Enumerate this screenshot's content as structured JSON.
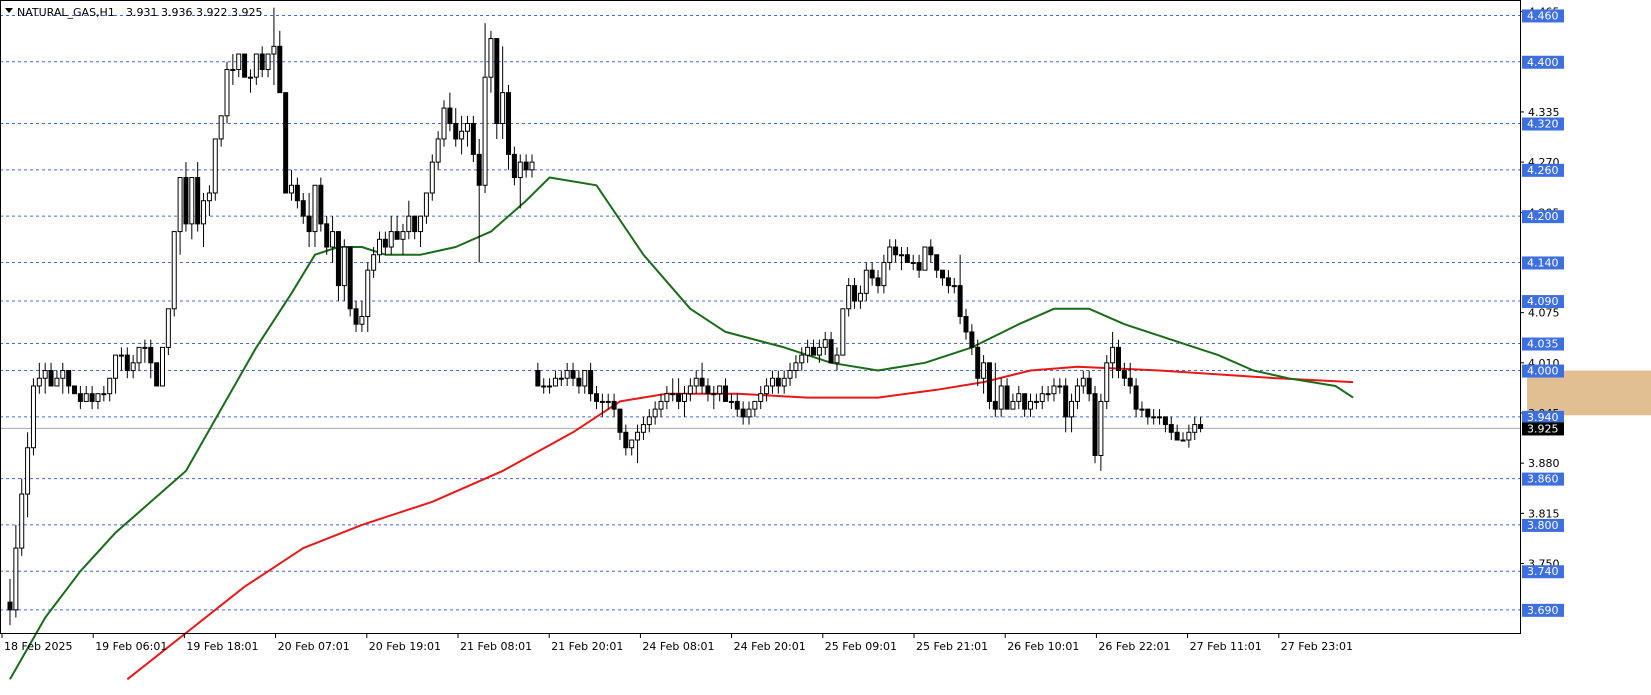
{
  "header": {
    "symbol": "NATURAL_GAS,H1",
    "ohlc": "3.931 3.936 3.922 3.925",
    "arrow_icon": "triangle-down-icon"
  },
  "colors": {
    "background": "#ffffff",
    "candle": "#000000",
    "grid_level": "#1f4fd6",
    "level_label_bg": "#3d6fe0",
    "current_price_bg": "#000000",
    "ma_fast": "#1a6b1a",
    "ma_slow": "#e81818",
    "zone_fill": "#deb887",
    "border": "#000000"
  },
  "chart_data": {
    "type": "candlestick",
    "title": "NATURAL_GAS,H1",
    "ylim": [
      3.66,
      4.48
    ],
    "price_levels": [
      4.46,
      4.4,
      4.32,
      4.26,
      4.2,
      4.14,
      4.09,
      4.035,
      4.0,
      3.94,
      3.86,
      3.8,
      3.74,
      3.69
    ],
    "price_level_labels": [
      "4.460",
      "4.400",
      "4.320",
      "4.260",
      "4.200",
      "4.140",
      "4.090",
      "4.035",
      "4.000",
      "3.940",
      "3.860",
      "3.800",
      "3.740",
      "3.690"
    ],
    "scale_ticks": [
      4.465,
      4.335,
      4.27,
      4.205,
      4.075,
      4.01,
      3.945,
      3.88,
      3.815,
      3.75
    ],
    "scale_tick_labels": [
      "4.465",
      "4.335",
      "4.270",
      "4.205",
      "4.075",
      "4.010",
      "3.945",
      "3.880",
      "3.815",
      "3.750"
    ],
    "current_price": 3.925,
    "current_price_label": "3.925",
    "time_labels": [
      "18 Feb 2025",
      "19 Feb 06:01",
      "19 Feb 18:01",
      "20 Feb 07:01",
      "20 Feb 19:01",
      "21 Feb 08:01",
      "21 Feb 20:01",
      "24 Feb 08:01",
      "24 Feb 20:01",
      "25 Feb 09:01",
      "25 Feb 21:01",
      "26 Feb 10:01",
      "26 Feb 22:01",
      "27 Feb 11:01",
      "27 Feb 23:01"
    ],
    "zone": {
      "from_bar": 259,
      "to_bar": 280,
      "low": 3.942,
      "high": 4.0
    },
    "candles": [
      [
        3.7,
        3.73,
        3.67,
        3.69
      ],
      [
        3.69,
        3.8,
        3.68,
        3.77
      ],
      [
        3.77,
        3.86,
        3.76,
        3.84
      ],
      [
        3.84,
        3.92,
        3.81,
        3.9
      ],
      [
        3.9,
        3.99,
        3.89,
        3.98
      ],
      [
        3.98,
        4.01,
        3.97,
        3.99
      ],
      [
        3.99,
        4.01,
        3.97,
        4.0
      ],
      [
        4.0,
        4.01,
        3.98,
        3.98
      ],
      [
        3.98,
        4.0,
        3.98,
        3.99
      ],
      [
        3.99,
        4.01,
        3.97,
        4.0
      ],
      [
        4.0,
        4.0,
        3.97,
        3.98
      ],
      [
        3.98,
        3.98,
        3.97,
        3.97
      ],
      [
        3.97,
        3.98,
        3.95,
        3.96
      ],
      [
        3.96,
        3.98,
        3.96,
        3.97
      ],
      [
        3.97,
        3.98,
        3.95,
        3.96
      ],
      [
        3.96,
        3.97,
        3.95,
        3.97
      ],
      [
        3.97,
        3.98,
        3.96,
        3.97
      ],
      [
        3.97,
        3.99,
        3.96,
        3.99
      ],
      [
        3.99,
        4.02,
        3.97,
        4.02
      ],
      [
        4.02,
        4.03,
        4.0,
        4.02
      ],
      [
        4.02,
        4.03,
        3.99,
        4.0
      ],
      [
        4.0,
        4.02,
        3.99,
        4.01
      ],
      [
        4.01,
        4.03,
        4.0,
        4.03
      ],
      [
        4.03,
        4.04,
        4.01,
        4.03
      ],
      [
        4.03,
        4.04,
        3.99,
        4.01
      ],
      [
        4.01,
        4.01,
        3.98,
        3.98
      ],
      [
        3.98,
        4.03,
        3.98,
        4.03
      ],
      [
        4.03,
        4.08,
        4.02,
        4.08
      ],
      [
        4.08,
        4.18,
        4.07,
        4.18
      ],
      [
        4.18,
        4.25,
        4.15,
        4.25
      ],
      [
        4.25,
        4.27,
        4.18,
        4.19
      ],
      [
        4.19,
        4.25,
        4.17,
        4.25
      ],
      [
        4.25,
        4.27,
        4.18,
        4.19
      ],
      [
        4.19,
        4.23,
        4.16,
        4.22
      ],
      [
        4.22,
        4.24,
        4.2,
        4.23
      ],
      [
        4.23,
        4.3,
        4.22,
        4.3
      ],
      [
        4.3,
        4.33,
        4.29,
        4.33
      ],
      [
        4.33,
        4.4,
        4.32,
        4.39
      ],
      [
        4.39,
        4.41,
        4.37,
        4.39
      ],
      [
        4.39,
        4.41,
        4.38,
        4.41
      ],
      [
        4.41,
        4.41,
        4.38,
        4.38
      ],
      [
        4.38,
        4.39,
        4.36,
        4.38
      ],
      [
        4.38,
        4.41,
        4.37,
        4.41
      ],
      [
        4.41,
        4.42,
        4.38,
        4.39
      ],
      [
        4.39,
        4.41,
        4.38,
        4.41
      ],
      [
        4.41,
        4.47,
        4.37,
        4.42
      ],
      [
        4.42,
        4.44,
        4.36,
        4.36
      ],
      [
        4.36,
        4.36,
        4.23,
        4.23
      ],
      [
        4.23,
        4.26,
        4.22,
        4.24
      ],
      [
        4.24,
        4.25,
        4.21,
        4.22
      ],
      [
        4.22,
        4.23,
        4.19,
        4.2
      ],
      [
        4.2,
        4.23,
        4.16,
        4.18
      ],
      [
        4.18,
        4.24,
        4.16,
        4.24
      ],
      [
        4.24,
        4.25,
        4.18,
        4.19
      ],
      [
        4.19,
        4.2,
        4.15,
        4.16
      ],
      [
        4.16,
        4.2,
        4.14,
        4.18
      ],
      [
        4.18,
        4.18,
        4.09,
        4.11
      ],
      [
        4.11,
        4.17,
        4.09,
        4.16
      ],
      [
        4.16,
        4.16,
        4.07,
        4.08
      ],
      [
        4.08,
        4.09,
        4.05,
        4.06
      ],
      [
        4.06,
        4.09,
        4.05,
        4.07
      ],
      [
        4.07,
        4.14,
        4.05,
        4.13
      ],
      [
        4.13,
        4.16,
        4.12,
        4.15
      ],
      [
        4.15,
        4.18,
        4.14,
        4.17
      ],
      [
        4.17,
        4.18,
        4.15,
        4.16
      ],
      [
        4.16,
        4.2,
        4.15,
        4.18
      ],
      [
        4.18,
        4.2,
        4.17,
        4.17
      ],
      [
        4.17,
        4.19,
        4.15,
        4.18
      ],
      [
        4.18,
        4.22,
        4.17,
        4.2
      ],
      [
        4.2,
        4.2,
        4.17,
        4.18
      ],
      [
        4.18,
        4.2,
        4.16,
        4.2
      ],
      [
        4.2,
        4.23,
        4.19,
        4.23
      ],
      [
        4.23,
        4.28,
        4.22,
        4.27
      ],
      [
        4.27,
        4.31,
        4.26,
        4.3
      ],
      [
        4.3,
        4.35,
        4.29,
        4.34
      ],
      [
        4.34,
        4.36,
        4.31,
        4.32
      ],
      [
        4.32,
        4.34,
        4.29,
        4.3
      ],
      [
        4.3,
        4.33,
        4.28,
        4.31
      ],
      [
        4.31,
        4.33,
        4.29,
        4.32
      ],
      [
        4.32,
        4.33,
        4.27,
        4.28
      ],
      [
        4.28,
        4.3,
        4.14,
        4.24
      ],
      [
        4.24,
        4.45,
        4.23,
        4.38
      ],
      [
        4.38,
        4.44,
        4.36,
        4.43
      ],
      [
        4.43,
        4.43,
        4.3,
        4.32
      ],
      [
        4.32,
        4.42,
        4.3,
        4.36
      ],
      [
        4.36,
        4.37,
        4.26,
        4.28
      ],
      [
        4.28,
        4.29,
        4.24,
        4.25
      ],
      [
        4.25,
        4.28,
        4.21,
        4.27
      ],
      [
        4.27,
        4.28,
        4.25,
        4.26
      ],
      [
        4.26,
        4.28,
        4.25,
        4.27
      ],
      [
        4.0,
        4.01,
        3.98,
        3.98
      ],
      [
        3.98,
        3.99,
        3.97,
        3.98
      ],
      [
        3.98,
        3.99,
        3.97,
        3.98
      ],
      [
        3.98,
        4.0,
        3.98,
        3.99
      ],
      [
        3.99,
        4.0,
        3.98,
        3.99
      ],
      [
        3.99,
        4.01,
        3.98,
        4.0
      ],
      [
        4.0,
        4.01,
        3.98,
        3.99
      ],
      [
        3.99,
        4.0,
        3.97,
        3.98
      ],
      [
        3.98,
        4.0,
        3.97,
        4.0
      ],
      [
        4.0,
        4.01,
        3.96,
        3.97
      ],
      [
        3.97,
        3.98,
        3.95,
        3.96
      ],
      [
        3.96,
        3.97,
        3.94,
        3.96
      ],
      [
        3.96,
        3.97,
        3.95,
        3.96
      ],
      [
        3.96,
        3.97,
        3.94,
        3.95
      ],
      [
        3.95,
        3.95,
        3.91,
        3.92
      ],
      [
        3.92,
        3.93,
        3.89,
        3.9
      ],
      [
        3.9,
        3.91,
        3.89,
        3.91
      ],
      [
        3.91,
        3.93,
        3.88,
        3.92
      ],
      [
        3.92,
        3.94,
        3.91,
        3.93
      ],
      [
        3.93,
        3.95,
        3.92,
        3.94
      ],
      [
        3.94,
        3.96,
        3.93,
        3.95
      ],
      [
        3.95,
        3.97,
        3.94,
        3.96
      ],
      [
        3.96,
        3.98,
        3.95,
        3.97
      ],
      [
        3.97,
        3.99,
        3.96,
        3.97
      ],
      [
        3.97,
        3.99,
        3.95,
        3.96
      ],
      [
        3.96,
        3.98,
        3.94,
        3.97
      ],
      [
        3.97,
        3.99,
        3.96,
        3.98
      ],
      [
        3.98,
        4.0,
        3.97,
        3.99
      ],
      [
        3.99,
        4.01,
        3.97,
        3.98
      ],
      [
        3.98,
        3.99,
        3.96,
        3.97
      ],
      [
        3.97,
        3.98,
        3.95,
        3.97
      ],
      [
        3.97,
        3.98,
        3.96,
        3.98
      ],
      [
        3.98,
        3.99,
        3.96,
        3.96
      ],
      [
        3.96,
        3.97,
        3.95,
        3.96
      ],
      [
        3.96,
        3.97,
        3.94,
        3.95
      ],
      [
        3.95,
        3.96,
        3.93,
        3.94
      ],
      [
        3.94,
        3.96,
        3.93,
        3.95
      ],
      [
        3.95,
        3.96,
        3.94,
        3.96
      ],
      [
        3.96,
        3.98,
        3.95,
        3.97
      ],
      [
        3.97,
        3.99,
        3.96,
        3.98
      ],
      [
        3.98,
        4.0,
        3.97,
        3.99
      ],
      [
        3.99,
        4.0,
        3.97,
        3.98
      ],
      [
        3.98,
        4.0,
        3.97,
        3.99
      ],
      [
        3.99,
        4.01,
        3.98,
        4.0
      ],
      [
        4.0,
        4.02,
        3.99,
        4.01
      ],
      [
        4.01,
        4.03,
        4.0,
        4.02
      ],
      [
        4.02,
        4.04,
        4.01,
        4.03
      ],
      [
        4.03,
        4.04,
        4.02,
        4.02
      ],
      [
        4.02,
        4.04,
        4.01,
        4.03
      ],
      [
        4.03,
        4.05,
        4.02,
        4.04
      ],
      [
        4.04,
        4.05,
        4.01,
        4.01
      ],
      [
        4.01,
        4.03,
        4.0,
        4.02
      ],
      [
        4.02,
        4.08,
        4.02,
        4.08
      ],
      [
        4.08,
        4.12,
        4.07,
        4.11
      ],
      [
        4.11,
        4.12,
        4.08,
        4.09
      ],
      [
        4.09,
        4.11,
        4.08,
        4.1
      ],
      [
        4.1,
        4.14,
        4.09,
        4.13
      ],
      [
        4.13,
        4.14,
        4.11,
        4.12
      ],
      [
        4.12,
        4.13,
        4.1,
        4.11
      ],
      [
        4.11,
        4.15,
        4.1,
        4.14
      ],
      [
        4.14,
        4.17,
        4.13,
        4.16
      ],
      [
        4.16,
        4.17,
        4.14,
        4.15
      ],
      [
        4.15,
        4.16,
        4.13,
        4.15
      ],
      [
        4.15,
        4.16,
        4.14,
        4.14
      ],
      [
        4.14,
        4.15,
        4.13,
        4.14
      ],
      [
        4.14,
        4.15,
        4.12,
        4.13
      ],
      [
        4.13,
        4.16,
        4.13,
        4.16
      ],
      [
        4.16,
        4.17,
        4.14,
        4.15
      ],
      [
        4.15,
        4.15,
        4.12,
        4.13
      ],
      [
        4.13,
        4.13,
        4.11,
        4.12
      ],
      [
        4.12,
        4.13,
        4.1,
        4.11
      ],
      [
        4.11,
        4.12,
        4.1,
        4.11
      ],
      [
        4.11,
        4.15,
        4.06,
        4.07
      ],
      [
        4.07,
        4.08,
        4.04,
        4.05
      ],
      [
        4.05,
        4.06,
        4.02,
        4.03
      ],
      [
        4.03,
        4.04,
        3.98,
        3.99
      ],
      [
        3.99,
        4.02,
        3.97,
        4.01
      ],
      [
        4.01,
        4.01,
        3.95,
        3.96
      ],
      [
        3.96,
        4.01,
        3.94,
        3.95
      ],
      [
        3.95,
        3.99,
        3.94,
        3.98
      ],
      [
        3.98,
        3.99,
        3.95,
        3.95
      ],
      [
        3.95,
        3.97,
        3.95,
        3.96
      ],
      [
        3.96,
        3.98,
        3.95,
        3.97
      ],
      [
        3.97,
        3.97,
        3.94,
        3.95
      ],
      [
        3.95,
        3.97,
        3.94,
        3.96
      ],
      [
        3.96,
        3.97,
        3.95,
        3.96
      ],
      [
        3.96,
        3.98,
        3.95,
        3.97
      ],
      [
        3.97,
        3.98,
        3.96,
        3.97
      ],
      [
        3.97,
        3.99,
        3.96,
        3.98
      ],
      [
        3.98,
        3.99,
        3.97,
        3.98
      ],
      [
        3.98,
        3.99,
        3.92,
        3.94
      ],
      [
        3.94,
        3.97,
        3.92,
        3.96
      ],
      [
        3.96,
        3.99,
        3.95,
        3.98
      ],
      [
        3.98,
        4.0,
        3.97,
        3.99
      ],
      [
        3.99,
        4.0,
        3.96,
        3.97
      ],
      [
        3.97,
        3.98,
        3.88,
        3.89
      ],
      [
        3.89,
        3.97,
        3.87,
        3.96
      ],
      [
        3.96,
        4.02,
        3.95,
        4.01
      ],
      [
        4.01,
        4.05,
        3.99,
        4.03
      ],
      [
        4.03,
        4.04,
        3.99,
        4.0
      ],
      [
        4.0,
        4.01,
        3.98,
        3.99
      ],
      [
        3.99,
        4.01,
        3.97,
        3.98
      ],
      [
        3.98,
        3.99,
        3.94,
        3.95
      ],
      [
        3.95,
        3.96,
        3.94,
        3.95
      ],
      [
        3.95,
        3.95,
        3.93,
        3.94
      ],
      [
        3.94,
        3.95,
        3.93,
        3.94
      ],
      [
        3.94,
        3.95,
        3.93,
        3.94
      ],
      [
        3.94,
        3.94,
        3.92,
        3.93
      ],
      [
        3.93,
        3.94,
        3.91,
        3.92
      ],
      [
        3.92,
        3.93,
        3.91,
        3.91
      ],
      [
        3.91,
        3.92,
        3.91,
        3.91
      ],
      [
        3.91,
        3.93,
        3.9,
        3.92
      ],
      [
        3.92,
        3.94,
        3.91,
        3.93
      ],
      [
        3.93,
        3.94,
        3.92,
        3.925
      ]
    ],
    "ma_fast_path": [
      [
        0,
        3.6
      ],
      [
        6,
        3.68
      ],
      [
        12,
        3.74
      ],
      [
        18,
        3.79
      ],
      [
        24,
        3.83
      ],
      [
        30,
        3.87
      ],
      [
        36,
        3.95
      ],
      [
        42,
        4.03
      ],
      [
        48,
        4.1
      ],
      [
        52,
        4.15
      ],
      [
        56,
        4.16
      ],
      [
        60,
        4.16
      ],
      [
        64,
        4.15
      ],
      [
        70,
        4.15
      ],
      [
        76,
        4.16
      ],
      [
        82,
        4.18
      ],
      [
        88,
        4.22
      ],
      [
        92,
        4.25
      ],
      [
        100,
        4.24
      ],
      [
        108,
        4.15
      ],
      [
        116,
        4.08
      ],
      [
        122,
        4.05
      ],
      [
        132,
        4.03
      ],
      [
        140,
        4.01
      ],
      [
        148,
        4.0
      ],
      [
        156,
        4.01
      ],
      [
        164,
        4.03
      ],
      [
        172,
        4.06
      ],
      [
        178,
        4.08
      ],
      [
        184,
        4.08
      ],
      [
        190,
        4.06
      ],
      [
        198,
        4.04
      ],
      [
        206,
        4.02
      ],
      [
        212,
        4.0
      ],
      [
        218,
        3.99
      ],
      [
        226,
        3.98
      ],
      [
        229,
        3.965
      ]
    ],
    "ma_slow_path": [
      [
        20,
        3.6
      ],
      [
        30,
        3.66
      ],
      [
        40,
        3.72
      ],
      [
        50,
        3.77
      ],
      [
        60,
        3.8
      ],
      [
        72,
        3.83
      ],
      [
        84,
        3.87
      ],
      [
        96,
        3.92
      ],
      [
        104,
        3.96
      ],
      [
        112,
        3.97
      ],
      [
        124,
        3.97
      ],
      [
        136,
        3.965
      ],
      [
        148,
        3.965
      ],
      [
        158,
        3.975
      ],
      [
        166,
        3.985
      ],
      [
        174,
        4.0
      ],
      [
        182,
        4.005
      ],
      [
        196,
        4.0
      ],
      [
        206,
        3.995
      ],
      [
        216,
        3.99
      ],
      [
        229,
        3.985
      ]
    ]
  }
}
